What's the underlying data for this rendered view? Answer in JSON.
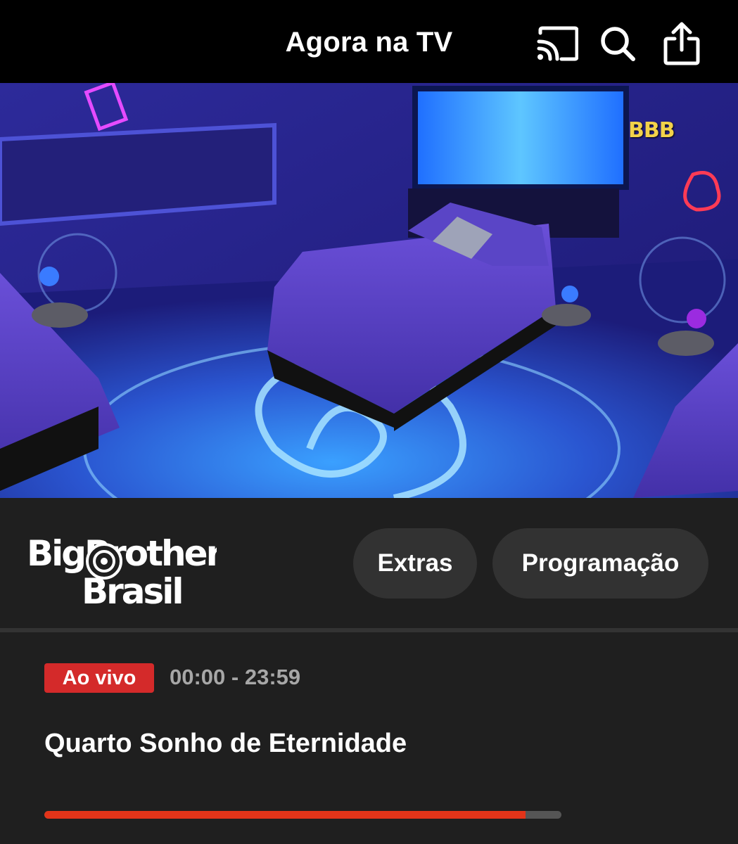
{
  "header": {
    "title": "Agora na TV",
    "icons": [
      "cast-icon",
      "search-icon",
      "share-icon"
    ]
  },
  "player": {
    "watermark": "BBB"
  },
  "show": {
    "logo_line1": "BigBrother",
    "logo_line2": "Brasil",
    "buttons": {
      "extras": "Extras",
      "schedule": "Programação"
    }
  },
  "now_playing": {
    "live_badge": "Ao vivo",
    "time_range": "00:00 - 23:59",
    "title": "Quarto Sonho de Eternidade",
    "progress": 0.93
  },
  "colors": {
    "live": "#d42a2a",
    "progress_fill": "#e23419",
    "pill_bg": "#323232"
  }
}
